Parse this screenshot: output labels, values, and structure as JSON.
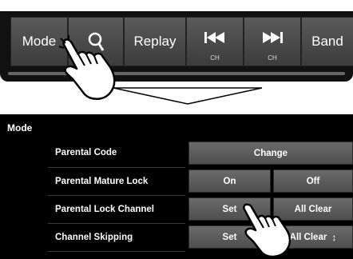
{
  "top_partial_text": "",
  "toolbar": {
    "mode_label": "Mode",
    "replay_label": "Replay",
    "band_label": "Band",
    "prev_ch_sub": "CH",
    "next_ch_sub": "CH",
    "icons": [
      "search-icon",
      "skip-previous-icon",
      "skip-next-icon"
    ]
  },
  "menu": {
    "title": "Mode",
    "rows": [
      {
        "label": "Parental Code",
        "options": [
          "Change"
        ]
      },
      {
        "label": "Parental Mature Lock",
        "options": [
          "On",
          "Off"
        ]
      },
      {
        "label": "Parental Lock Channel",
        "options": [
          "Set",
          "All Clear"
        ]
      },
      {
        "label": "Channel Skipping",
        "options": [
          "Set",
          "All Clear"
        ]
      }
    ],
    "scroll_glyph": "↕"
  },
  "colors": {
    "panel": "#111111",
    "button": "#555555",
    "menu_bg": "#000000"
  }
}
